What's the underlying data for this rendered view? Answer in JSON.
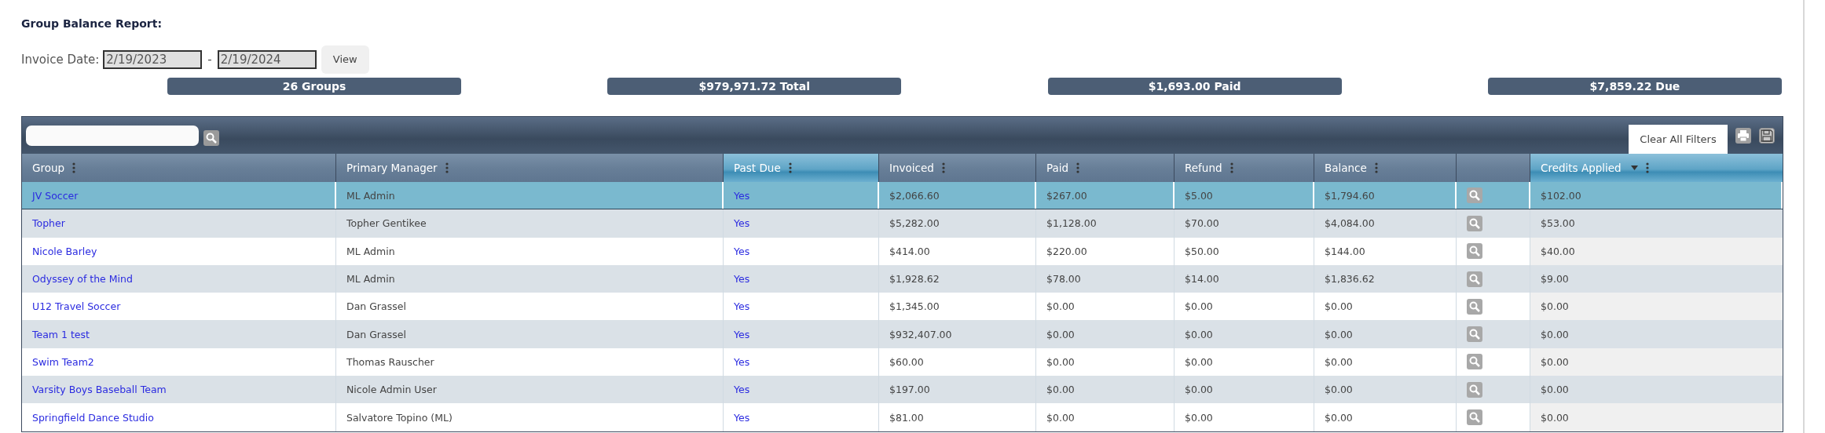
{
  "title": "Group Balance Report:",
  "invoice_date": {
    "label": "Invoice Date:",
    "from": "2/19/2023",
    "separator": "-",
    "to": "2/19/2024",
    "button": "View"
  },
  "summary": [
    "26 Groups",
    "$979,971.72 Total",
    "$1,693.00 Paid",
    "$7,859.22 Due"
  ],
  "toolbar": {
    "clear_button": "Clear All Filters"
  },
  "table": {
    "columns": [
      {
        "label": "Group",
        "sorted": false,
        "kind": "text"
      },
      {
        "label": "Primary Manager",
        "sorted": false,
        "kind": "text"
      },
      {
        "label": "Past Due",
        "sorted": true,
        "kind": "text"
      },
      {
        "label": "Invoiced",
        "sorted": false,
        "kind": "text"
      },
      {
        "label": "Paid",
        "sorted": false,
        "kind": "text"
      },
      {
        "label": "Refund",
        "sorted": false,
        "kind": "text"
      },
      {
        "label": "Balance",
        "sorted": false,
        "kind": "text"
      },
      {
        "kind": "action",
        "sorted": false
      },
      {
        "label": "Credits Applied",
        "sorted": true,
        "kind": "text",
        "sort_arrow": true
      }
    ],
    "rows": [
      {
        "selected": true,
        "cells": [
          "JV Soccer",
          "ML Admin",
          "Yes",
          "$2,066.60",
          "$267.00",
          "$5.00",
          "$1,794.60",
          "$102.00"
        ]
      },
      {
        "selected": false,
        "cells": [
          "Topher",
          "Topher Gentikee",
          "Yes",
          "$5,282.00",
          "$1,128.00",
          "$70.00",
          "$4,084.00",
          "$53.00"
        ]
      },
      {
        "selected": false,
        "cells": [
          "Nicole Barley",
          "ML Admin",
          "Yes",
          "$414.00",
          "$220.00",
          "$50.00",
          "$144.00",
          "$40.00"
        ]
      },
      {
        "selected": false,
        "cells": [
          "Odyssey of the Mind",
          "ML Admin",
          "Yes",
          "$1,928.62",
          "$78.00",
          "$14.00",
          "$1,836.62",
          "$9.00"
        ]
      },
      {
        "selected": false,
        "cells": [
          "U12 Travel Soccer",
          "Dan Grassel",
          "Yes",
          "$1,345.00",
          "$0.00",
          "$0.00",
          "$0.00",
          "$0.00"
        ]
      },
      {
        "selected": false,
        "cells": [
          "Team 1 test",
          "Dan Grassel",
          "Yes",
          "$932,407.00",
          "$0.00",
          "$0.00",
          "$0.00",
          "$0.00"
        ]
      },
      {
        "selected": false,
        "cells": [
          "Swim Team2",
          "Thomas Rauscher",
          "Yes",
          "$60.00",
          "$0.00",
          "$0.00",
          "$0.00",
          "$0.00"
        ]
      },
      {
        "selected": false,
        "cells": [
          "Varsity Boys Baseball Team",
          "Nicole Admin User",
          "Yes",
          "$197.00",
          "$0.00",
          "$0.00",
          "$0.00",
          "$0.00"
        ]
      },
      {
        "selected": false,
        "cells": [
          "Springfield Dance Studio",
          "Salvatore Topino (ML)",
          "Yes",
          "$81.00",
          "$0.00",
          "$0.00",
          "$0.00",
          "$0.00"
        ]
      }
    ]
  }
}
